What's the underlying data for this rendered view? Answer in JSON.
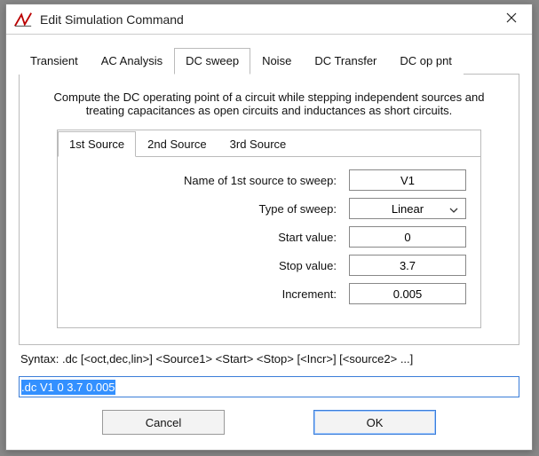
{
  "window": {
    "title": "Edit Simulation Command"
  },
  "tabs": {
    "items": [
      {
        "label": "Transient"
      },
      {
        "label": "AC Analysis"
      },
      {
        "label": "DC sweep"
      },
      {
        "label": "Noise"
      },
      {
        "label": "DC Transfer"
      },
      {
        "label": "DC op pnt"
      }
    ],
    "active": 2
  },
  "description": "Compute the DC operating point of a circuit while stepping independent sources and treating capacitances as open circuits and inductances as short circuits.",
  "subtabs": {
    "items": [
      {
        "label": "1st Source"
      },
      {
        "label": "2nd Source"
      },
      {
        "label": "3rd Source"
      }
    ],
    "active": 0
  },
  "form": {
    "name_label": "Name of 1st source to sweep:",
    "name_value": "V1",
    "type_label": "Type of sweep:",
    "type_value": "Linear",
    "start_label": "Start value:",
    "start_value": "0",
    "stop_label": "Stop value:",
    "stop_value": "3.7",
    "incr_label": "Increment:",
    "incr_value": "0.005"
  },
  "syntax": {
    "label": "Syntax:  .dc [<oct,dec,lin>] <Source1> <Start> <Stop> [<Incr>] [<source2> ...]"
  },
  "command_value": ".dc V1 0 3.7 0.005",
  "buttons": {
    "cancel": "Cancel",
    "ok": "OK"
  }
}
